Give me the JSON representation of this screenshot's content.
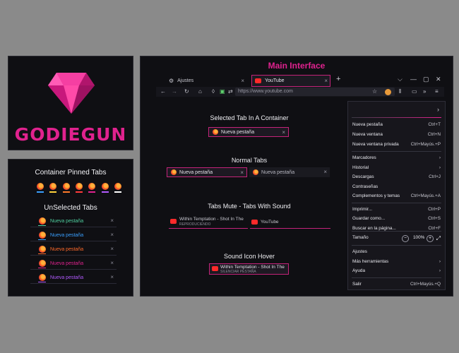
{
  "logo": {
    "text": "GODIEGUN"
  },
  "pinned_panel": {
    "title": "Container Pinned Tabs",
    "pinned_underline_colors": [
      "#3aa0ff",
      "#ffd23a",
      "#ff7a2a",
      "#ff3a3a",
      "#e0228e",
      "#b25aff",
      "#ffffff"
    ],
    "unselected_title": "UnSelected Tabs",
    "tabs": [
      {
        "label": "Nueva pestaña",
        "color": "#50d0a0"
      },
      {
        "label": "Nueva pestaña",
        "color": "#3aa0ff"
      },
      {
        "label": "Nueva pestaña",
        "color": "#ff6a2a"
      },
      {
        "label": "Nueva pestaña",
        "color": "#e0228e"
      },
      {
        "label": "Nueva pestaña",
        "color": "#b25aff"
      }
    ],
    "close_glyph": "×"
  },
  "main": {
    "title": "Main Interface",
    "tabs": {
      "settings": "Ajustes",
      "youtube": "YouTube",
      "new_tab_plus": "+"
    },
    "window_controls": {
      "dropdown": "⌵",
      "minimize": "—",
      "maximize": "▢",
      "close": "✕"
    },
    "url": "https://www.youtube.com",
    "sections": {
      "selected": {
        "title": "Selected Tab In A Container",
        "tab": "Nueva pestaña"
      },
      "normal": {
        "title": "Normal Tabs",
        "tab1": "Nueva pestaña",
        "tab2": "Nueva pestaña"
      },
      "mute": {
        "title": "Tabs Mute - Tabs With Sound",
        "tab1": "Within Temptation - Shot In The",
        "tab1_sub": "REPRODUCIENDO",
        "tab2": "YouTube"
      },
      "hover": {
        "title": "Sound Icon Hover",
        "tab": "Within Temptation - Shot In The",
        "tab_sub": "SILENCIAR PESTAÑA"
      }
    },
    "menu": {
      "items1": [
        {
          "label": "Nueva pestaña",
          "shortcut": "Ctrl+T"
        },
        {
          "label": "Nueva ventana",
          "shortcut": "Ctrl+N"
        },
        {
          "label": "Nueva ventana privada",
          "shortcut": "Ctrl+Mayús.+P"
        }
      ],
      "items2": [
        {
          "label": "Marcadores",
          "shortcut": "›"
        },
        {
          "label": "Historial",
          "shortcut": "›"
        },
        {
          "label": "Descargas",
          "shortcut": "Ctrl+J"
        },
        {
          "label": "Contraseñas",
          "shortcut": ""
        },
        {
          "label": "Complementos y temas",
          "shortcut": "Ctrl+Mayús.+A"
        }
      ],
      "items3": [
        {
          "label": "Imprimir...",
          "shortcut": "Ctrl+P"
        },
        {
          "label": "Guardar como...",
          "shortcut": "Ctrl+S"
        },
        {
          "label": "Buscar en la página...",
          "shortcut": "Ctrl+F"
        }
      ],
      "zoom": {
        "label": "Tamaño",
        "minus": "−",
        "value": "100%",
        "plus": "+"
      },
      "items4": [
        {
          "label": "Ajustes",
          "shortcut": ""
        },
        {
          "label": "Más herramientas",
          "shortcut": "›"
        },
        {
          "label": "Ayuda",
          "shortcut": "›"
        }
      ],
      "exit": {
        "label": "Salir",
        "shortcut": "Ctrl+Mayús.+Q"
      }
    },
    "colors": {
      "accent": "#e0228e",
      "panel_bg": "#0f0f13",
      "tab_border": "#c4237a"
    }
  }
}
